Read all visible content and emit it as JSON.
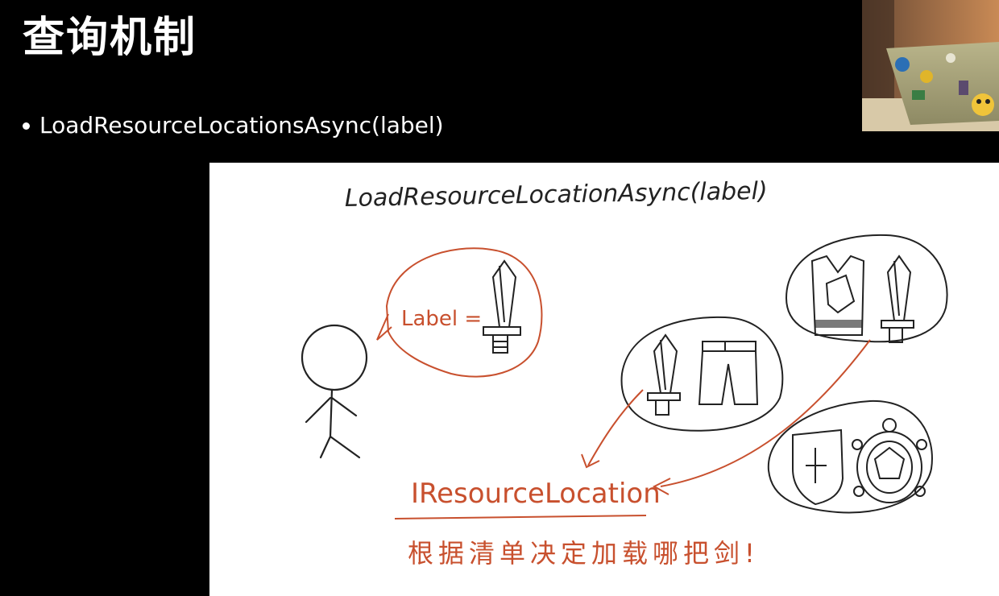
{
  "slide": {
    "title": "查询机制",
    "bullet": "LoadResourceLocationsAsync(label)"
  },
  "whiteboard": {
    "heading": "LoadResourceLocationAsync(label)",
    "bubble_text": "Label =",
    "result_label": "IResourceLocation",
    "note": "根据清单决定加载哪把剑!"
  },
  "colors": {
    "ink": "#222222",
    "accent": "#c8502e",
    "background": "#000000",
    "board": "#ffffff"
  }
}
